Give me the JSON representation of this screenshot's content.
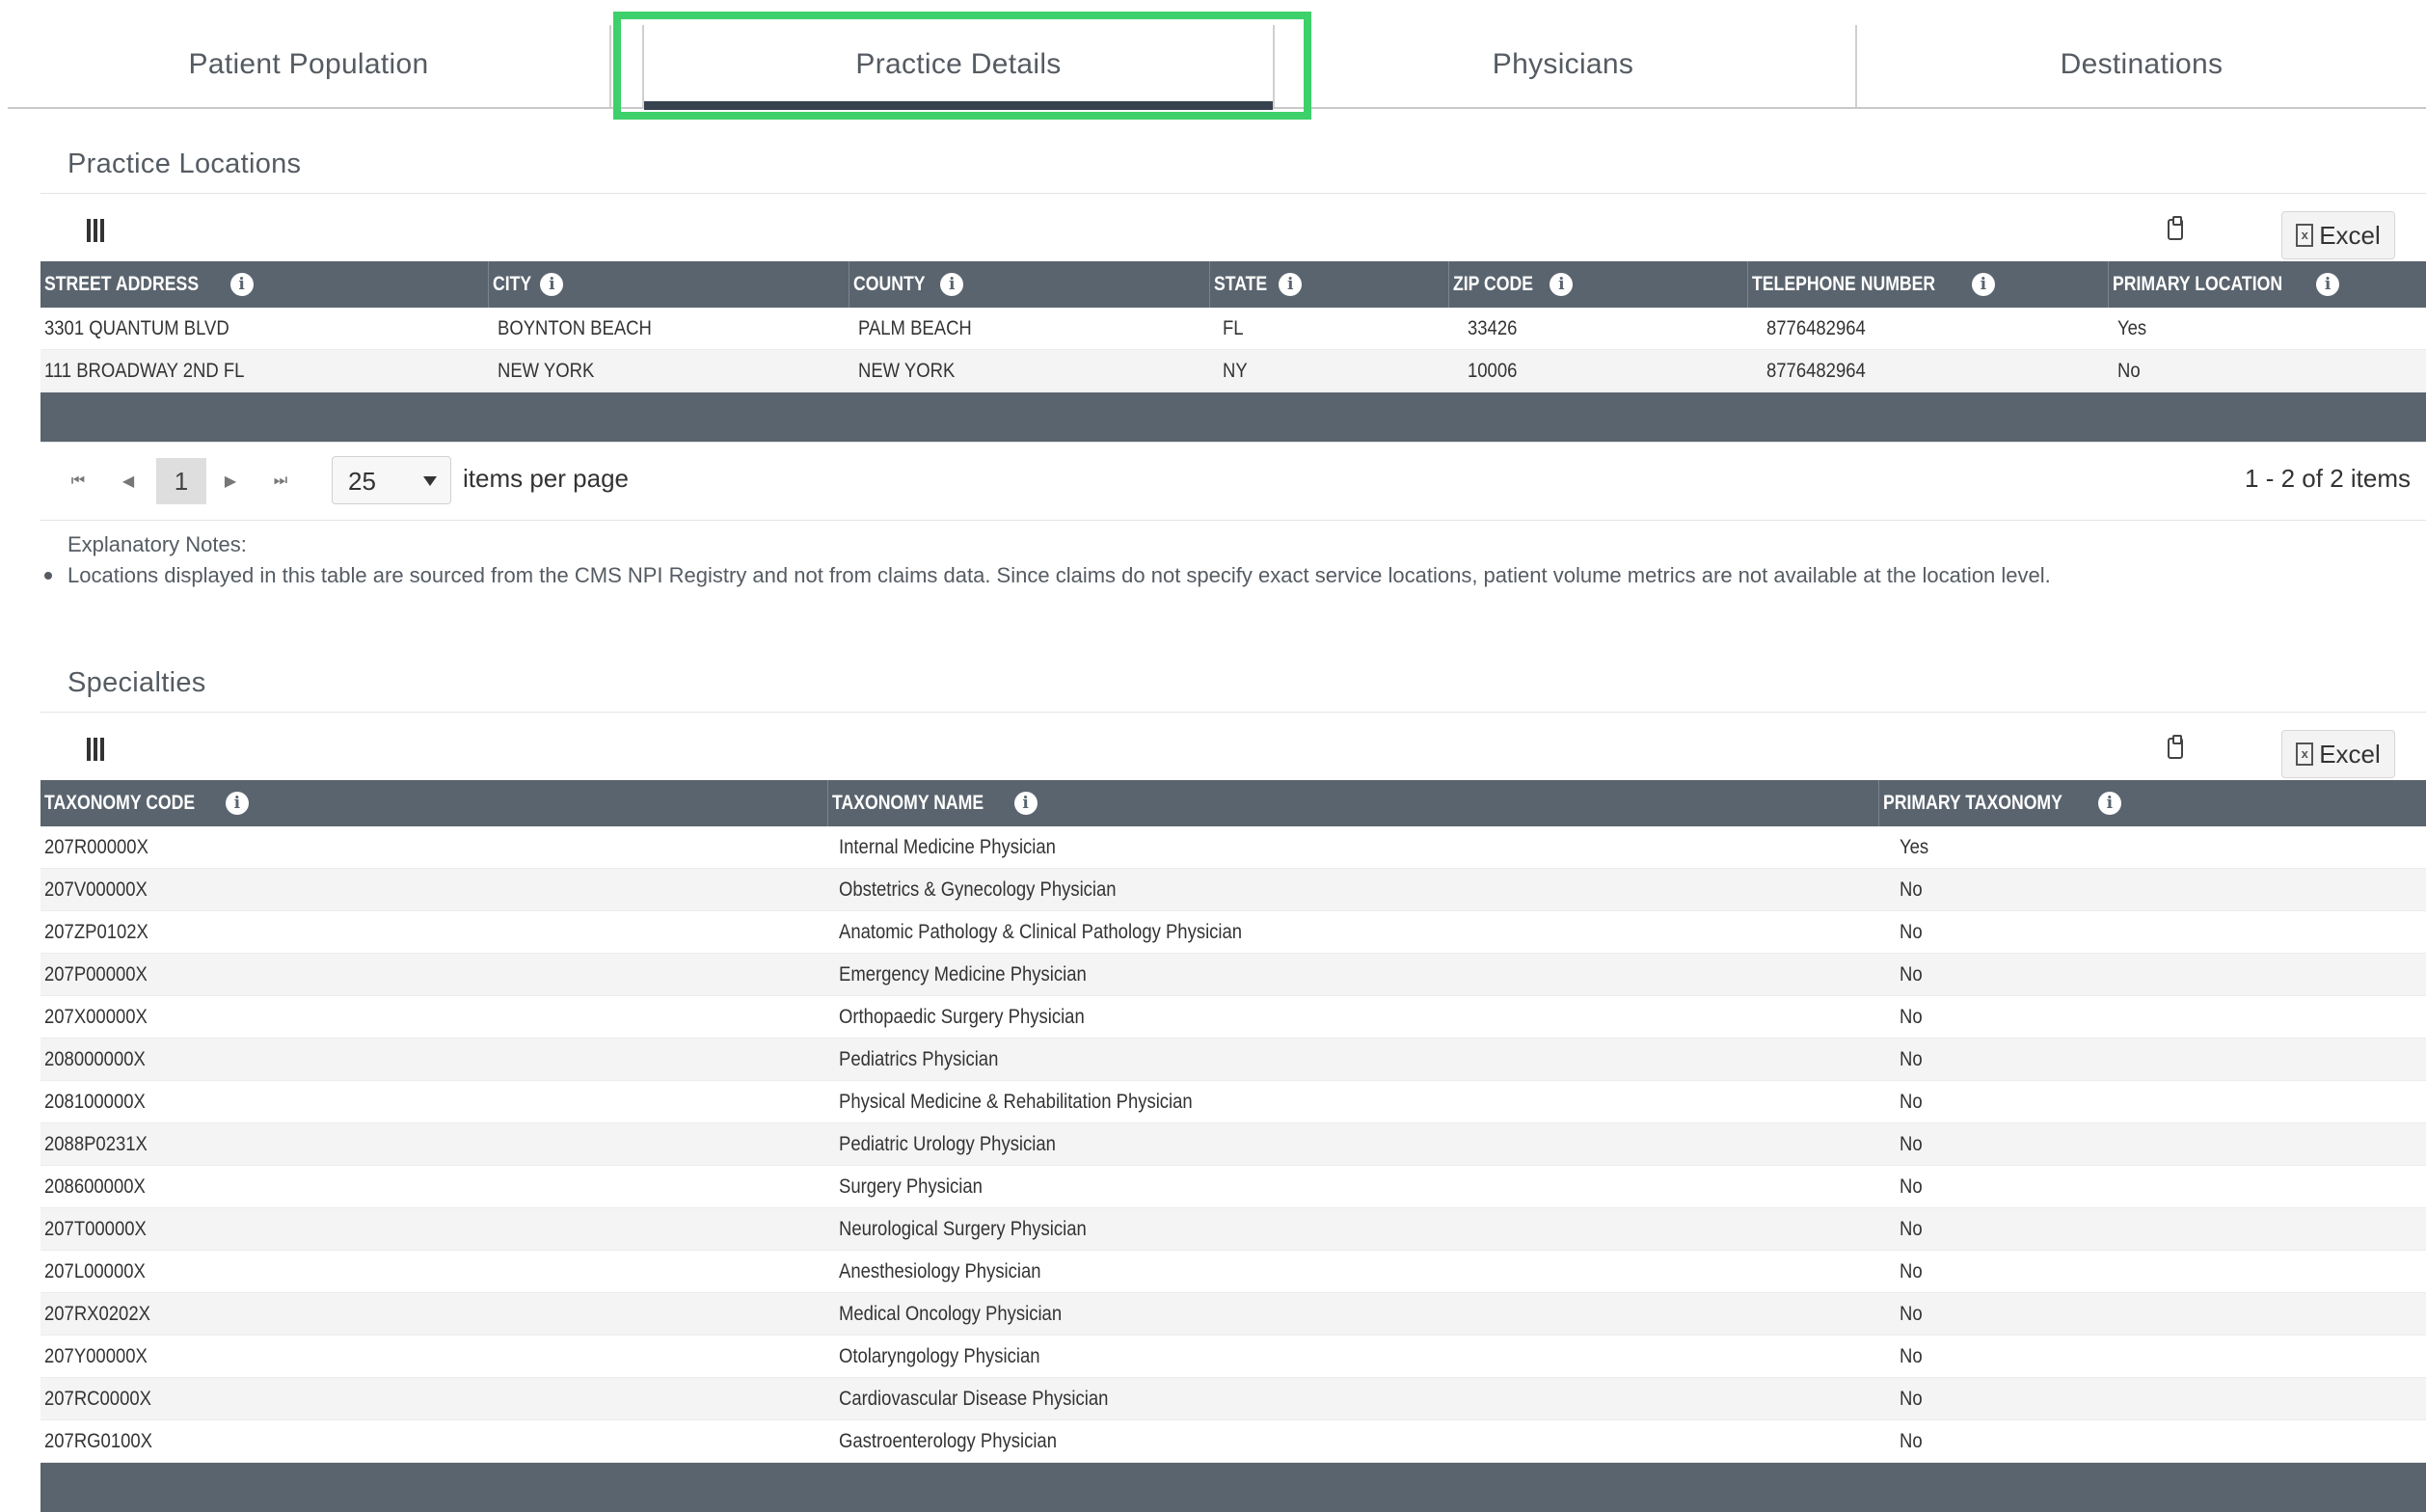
{
  "tabs": [
    {
      "label": "Patient Population"
    },
    {
      "label": "Practice Details"
    },
    {
      "label": "Physicians"
    },
    {
      "label": "Destinations"
    }
  ],
  "active_tab": "Practice Details",
  "colors": {
    "highlight": "#3ed06a",
    "header_bg": "#5a646e",
    "tab_indicator": "#37424f"
  },
  "locations": {
    "title": "Practice Locations",
    "excel_label": "Excel",
    "columns": [
      "STREET ADDRESS",
      "CITY",
      "COUNTY",
      "STATE",
      "ZIP CODE",
      "TELEPHONE NUMBER",
      "PRIMARY LOCATION"
    ],
    "rows": [
      [
        "3301 QUANTUM BLVD",
        "BOYNTON BEACH",
        "PALM BEACH",
        "FL",
        "33426",
        "8776482964",
        "Yes"
      ],
      [
        "111 BROADWAY 2ND FL",
        "NEW YORK",
        "NEW YORK",
        "NY",
        "10006",
        "8776482964",
        "No"
      ]
    ],
    "pager": {
      "current_page": "1",
      "page_size": "25",
      "page_size_label": "items per page",
      "info": "1 - 2 of 2 items"
    }
  },
  "notes": {
    "title": "Explanatory Notes:",
    "items": [
      "Locations displayed in this table are sourced from the CMS NPI Registry and not from claims data. Since claims do not specify exact service locations, patient volume metrics are not available at the location level."
    ]
  },
  "specialties": {
    "title": "Specialties",
    "excel_label": "Excel",
    "columns": [
      "TAXONOMY CODE",
      "TAXONOMY NAME",
      "PRIMARY TAXONOMY"
    ],
    "rows": [
      [
        "207R00000X",
        "Internal Medicine Physician",
        "Yes"
      ],
      [
        "207V00000X",
        "Obstetrics & Gynecology Physician",
        "No"
      ],
      [
        "207ZP0102X",
        "Anatomic Pathology & Clinical Pathology Physician",
        "No"
      ],
      [
        "207P00000X",
        "Emergency Medicine Physician",
        "No"
      ],
      [
        "207X00000X",
        "Orthopaedic Surgery Physician",
        "No"
      ],
      [
        "208000000X",
        "Pediatrics Physician",
        "No"
      ],
      [
        "208100000X",
        "Physical Medicine & Rehabilitation Physician",
        "No"
      ],
      [
        "2088P0231X",
        "Pediatric Urology Physician",
        "No"
      ],
      [
        "208600000X",
        "Surgery Physician",
        "No"
      ],
      [
        "207T00000X",
        "Neurological Surgery Physician",
        "No"
      ],
      [
        "207L00000X",
        "Anesthesiology Physician",
        "No"
      ],
      [
        "207RX0202X",
        "Medical Oncology Physician",
        "No"
      ],
      [
        "207Y00000X",
        "Otolaryngology Physician",
        "No"
      ],
      [
        "207RC0000X",
        "Cardiovascular Disease Physician",
        "No"
      ],
      [
        "207RG0100X",
        "Gastroenterology Physician",
        "No"
      ]
    ]
  }
}
